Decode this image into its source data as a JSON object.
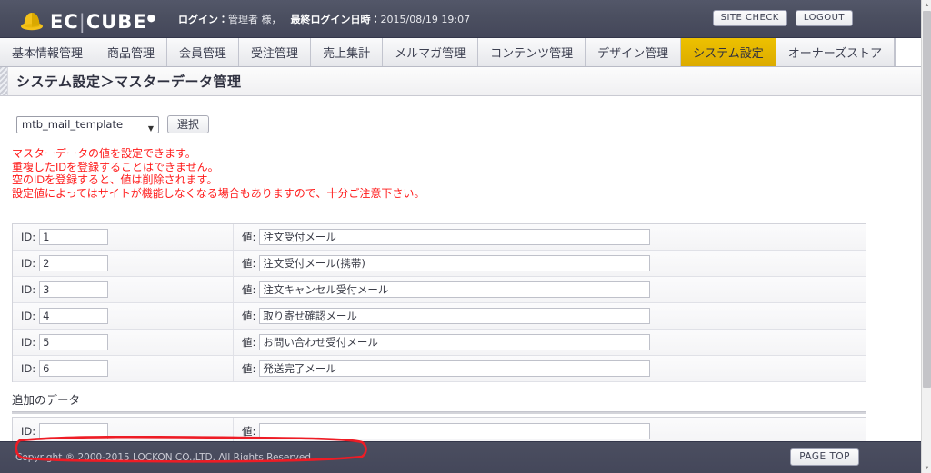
{
  "header": {
    "logo_text_ec": "EC",
    "logo_separator": "|",
    "logo_text_cube": "CUBE",
    "logo_dot": "●",
    "logo_icon": "eccube-hat-icon",
    "login_label": "ログイン：",
    "login_user": "管理者 様，",
    "last_login_label": "最終ログイン日時：",
    "last_login_value": "2015/08/19 19:07",
    "site_check_label": "SITE CHECK",
    "logout_label": "LOGOUT"
  },
  "nav": {
    "items": [
      {
        "label": "基本情報管理",
        "name": "nav-item-basic-info",
        "active": false
      },
      {
        "label": "商品管理",
        "name": "nav-item-products",
        "active": false
      },
      {
        "label": "会員管理",
        "name": "nav-item-members",
        "active": false
      },
      {
        "label": "受注管理",
        "name": "nav-item-orders",
        "active": false
      },
      {
        "label": "売上集計",
        "name": "nav-item-sales",
        "active": false
      },
      {
        "label": "メルマガ管理",
        "name": "nav-item-mailmagazine",
        "active": false
      },
      {
        "label": "コンテンツ管理",
        "name": "nav-item-contents",
        "active": false
      },
      {
        "label": "デザイン管理",
        "name": "nav-item-design",
        "active": false
      },
      {
        "label": "システム設定",
        "name": "nav-item-system-settings",
        "active": true
      },
      {
        "label": "オーナーズストア",
        "name": "nav-item-owners-store",
        "active": false
      }
    ]
  },
  "page": {
    "title": "システム設定＞マスターデータ管理"
  },
  "selector": {
    "selected": "mtb_mail_template",
    "caret": "▼",
    "button_label": "選択"
  },
  "warnings": [
    "マスターデータの値を設定できます。",
    "重複したIDを登録することはできません。",
    "空のIDを登録すると、値は削除されます。",
    "設定値によってはサイトが機能しなくなる場合もありますので、十分ご注意下さい。"
  ],
  "table": {
    "id_label": "ID:",
    "value_label": "値:",
    "rows": [
      {
        "id": "1",
        "value": "注文受付メール"
      },
      {
        "id": "2",
        "value": "注文受付メール(携帯)"
      },
      {
        "id": "3",
        "value": "注文キャンセル受付メール"
      },
      {
        "id": "4",
        "value": "取り寄せ確認メール"
      },
      {
        "id": "5",
        "value": "お問い合わせ受付メール"
      },
      {
        "id": "6",
        "value": "発送完了メール"
      }
    ],
    "highlighted_row_index": 5
  },
  "additional": {
    "title": "追加のデータ",
    "id_label": "ID:",
    "value_label": "値:",
    "id_value": "",
    "value_value": ""
  },
  "footer": {
    "copyright": "Copyright ® 2000-2015 LOCKON CO.,LTD. All Rights Reserved.",
    "page_top_label": "PAGE TOP"
  },
  "annotation": {
    "color": "#ee1c25",
    "shape": "hand-drawn-rounded-rectangle",
    "target": "row-id-6"
  },
  "colors": {
    "header_bg": "#474b5e",
    "nav_active": "#dcab00",
    "warning_text": "#ff1a1a",
    "annotation_red": "#ee1c25",
    "footer_bg": "#44475a"
  },
  "scrollbar": {
    "up_arrow": "▲",
    "down_arrow": "▼"
  }
}
